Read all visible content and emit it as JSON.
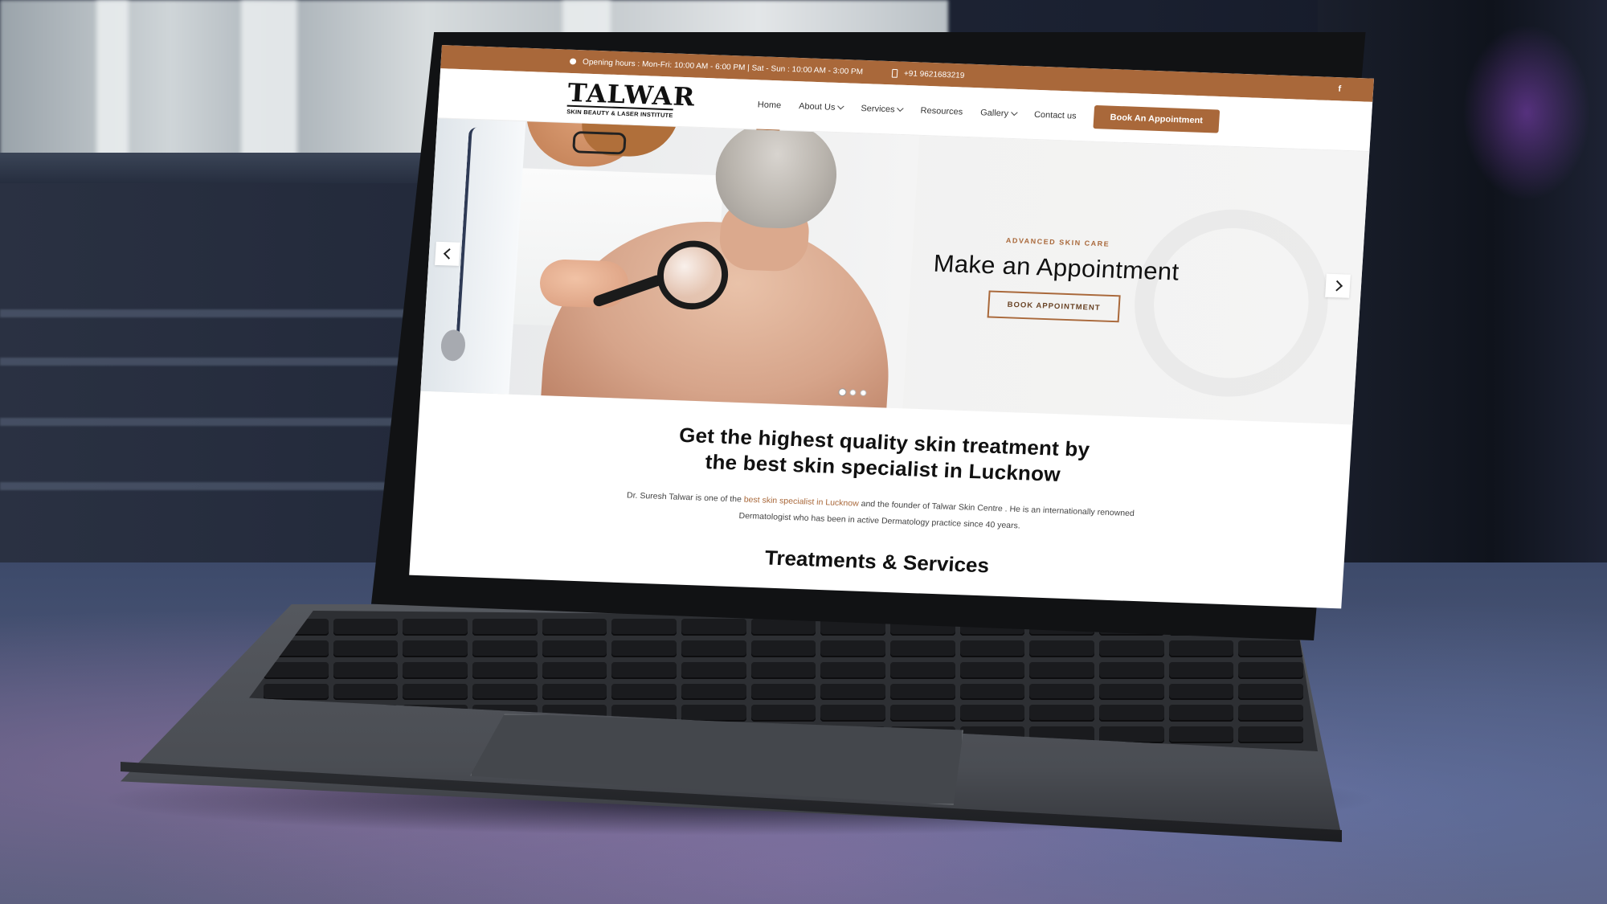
{
  "topbar": {
    "hours": "Opening hours : Mon-Fri: 10:00 AM - 6:00 PM | Sat - Sun : 10:00 AM - 3:00 PM",
    "phone": "+91 9621683219",
    "social": "f"
  },
  "brand": {
    "name": "TALWAR",
    "tagline": "SKIN BEAUTY & LASER INSTITUTE"
  },
  "nav": {
    "items": [
      {
        "label": "Home",
        "active": true
      },
      {
        "label": "About Us",
        "dropdown": true
      },
      {
        "label": "Services",
        "dropdown": true
      },
      {
        "label": "Resources"
      },
      {
        "label": "Gallery",
        "dropdown": true
      },
      {
        "label": "Contact us"
      }
    ],
    "cta": "Book An Appointment"
  },
  "hero": {
    "eyebrow": "ADVANCED SKIN CARE",
    "title": "Make an Appointment",
    "button": "BOOK APPOINTMENT",
    "slides": 3,
    "active_slide": 1
  },
  "content": {
    "headline_line1": "Get the highest quality skin treatment by",
    "headline_line2": "the best skin specialist in Lucknow",
    "intro_pre": "Dr. Suresh Talwar is one of the ",
    "intro_link": "best skin specialist in Lucknow",
    "intro_mid": " and the founder of Talwar Skin Centre . He is an internationally renowned",
    "intro_line2": "Dermatologist who has been in active Dermatology practice since 40 years.",
    "section_title": "Treatments & Services"
  },
  "colors": {
    "accent": "#a9683a"
  }
}
